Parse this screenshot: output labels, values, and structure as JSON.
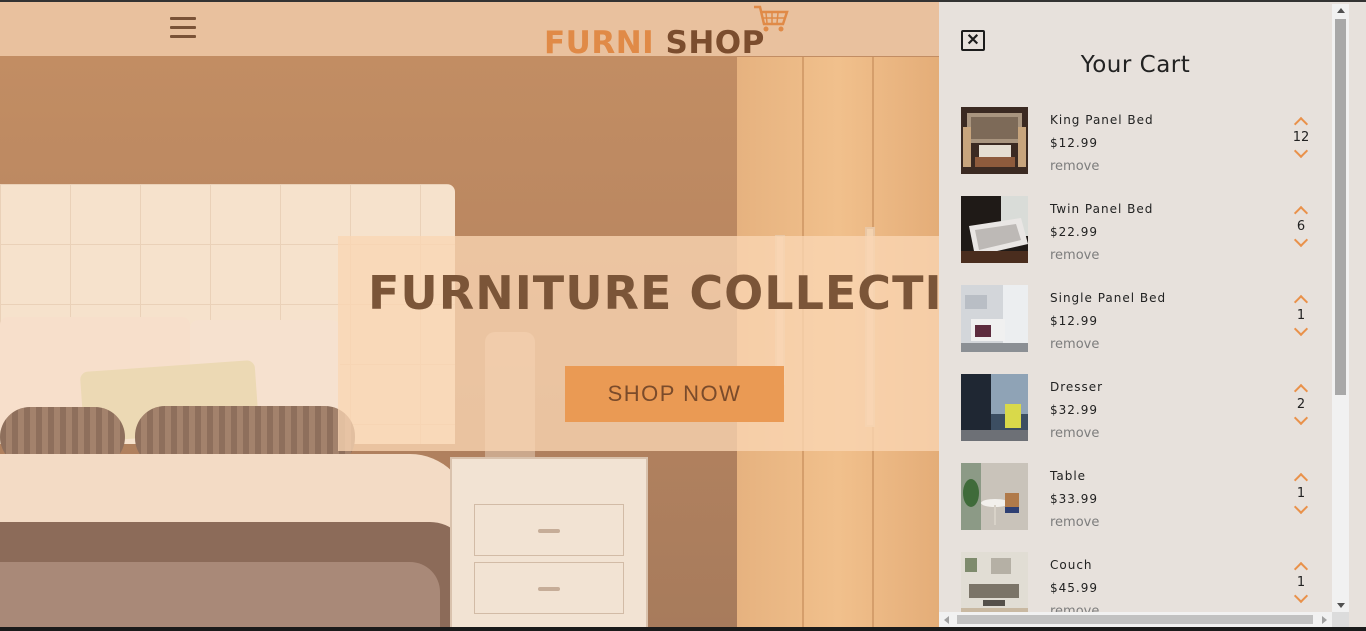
{
  "header": {
    "logo_part1": "FURNI",
    "logo_part2": "SHOP",
    "menu_icon": "hamburger-menu-icon",
    "cart_icon": "shopping-cart-icon"
  },
  "banner": {
    "title": "FURNITURE COLLECTION",
    "button_label": "SHOP NOW"
  },
  "cart": {
    "close_icon": "close-icon",
    "title": "Your Cart",
    "remove_label": "remove",
    "items": [
      {
        "name": "King Panel Bed",
        "price": "$12.99",
        "remove": "remove",
        "qty": "12"
      },
      {
        "name": "Twin Panel Bed",
        "price": "$22.99",
        "remove": "remove",
        "qty": "6"
      },
      {
        "name": "Single Panel Bed",
        "price": "$12.99",
        "remove": "remove",
        "qty": "1"
      },
      {
        "name": "Dresser",
        "price": "$32.99",
        "remove": "remove",
        "qty": "2"
      },
      {
        "name": "Table",
        "price": "$33.99",
        "remove": "remove",
        "qty": "1"
      },
      {
        "name": "Couch",
        "price": "$45.99",
        "remove": "remove",
        "qty": "1"
      }
    ]
  },
  "colors": {
    "accent": "#ea9a54",
    "brand_dark": "#7b4d2e",
    "cart_bg": "#e7e1dc"
  }
}
